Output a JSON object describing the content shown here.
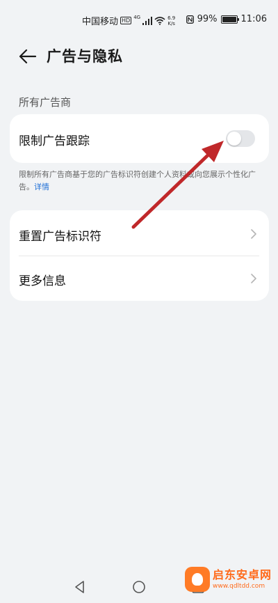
{
  "status_bar": {
    "carrier": "中国移动",
    "hd": "HD",
    "network": "4G",
    "speed_value": "6.9",
    "speed_unit": "K/s",
    "battery": "99%",
    "battery_level": 0.99,
    "time": "11:06"
  },
  "header": {
    "title": "广告与隐私"
  },
  "section": {
    "title": "所有广告商"
  },
  "toggle_card": {
    "label": "限制广告跟踪",
    "enabled": false
  },
  "footnote": {
    "text": "限制所有广告商基于您的广告标识符创建个人资料或向您展示个性化广告。",
    "link": "详情"
  },
  "list": {
    "items": [
      {
        "label": "重置广告标识符"
      },
      {
        "label": "更多信息"
      }
    ]
  },
  "watermark": {
    "title": "启东安卓网",
    "url": "www.qdltdd.com"
  },
  "colors": {
    "background": "#f1f3f5",
    "card": "#ffffff",
    "link": "#1f6fd6",
    "toggle_off": "#e4e6e9",
    "annotation_arrow": "#c0282a",
    "watermark": "#ff6a1a"
  }
}
